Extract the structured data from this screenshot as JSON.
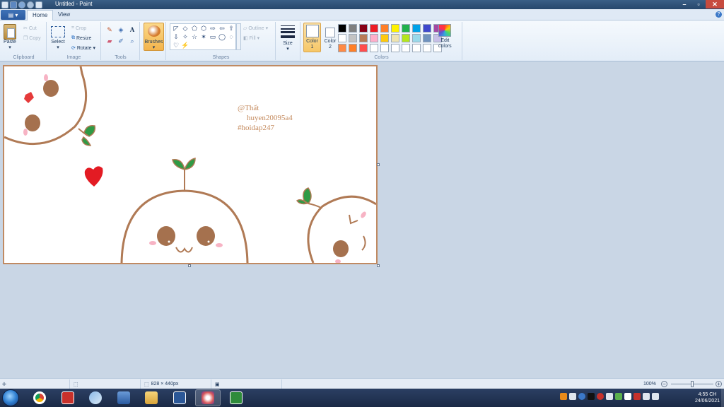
{
  "window": {
    "title": "Untitled - Paint"
  },
  "window_buttons": {
    "minimize": "–",
    "maximize": "▫",
    "close": "✕"
  },
  "tabs": {
    "file": "▤ ▾",
    "home": "Home",
    "view": "View"
  },
  "help": "?",
  "clipboard": {
    "label": "Clipboard",
    "paste": "Paste",
    "cut": "Cut",
    "copy": "Copy"
  },
  "image": {
    "label": "Image",
    "select": "Select",
    "crop": "Crop",
    "resize": "Resize",
    "rotate": "Rotate"
  },
  "tools": {
    "label": "Tools",
    "text_tool": "A"
  },
  "brushes": {
    "label": "Brushes"
  },
  "shapes": {
    "label": "Shapes",
    "glyphs": [
      "◸",
      "◇",
      "⬠",
      "⬡",
      "⇨",
      "⇦",
      "⇧",
      "⇩",
      "✧",
      "☆",
      "✶",
      "▭",
      "◯",
      "◌",
      "♡",
      "⚡"
    ],
    "outline": "Outline",
    "fill": "Fill"
  },
  "size": {
    "label": "Size"
  },
  "colors": {
    "label": "Colors",
    "color1": "Color\n1",
    "color2": "Color\n2",
    "edit": "Edit\ncolors",
    "palette": [
      "#000000",
      "#7f7f7f",
      "#880015",
      "#ed1c24",
      "#ff7f27",
      "#fff200",
      "#22b14c",
      "#00a2e8",
      "#3f48cc",
      "#a349a4",
      "#ffffff",
      "#c3c3c3",
      "#b97a57",
      "#ffaec9",
      "#ffc90e",
      "#efe4b0",
      "#b5e61d",
      "#99d9ea",
      "#7092be",
      "#c8bfe7",
      "#ff8a45",
      "#ff7f27",
      "#ff4d4d",
      "#ffffff",
      "#ffffff",
      "#ffffff",
      "#ffffff",
      "#ffffff",
      "#ffffff",
      "#ffffff"
    ]
  },
  "canvas_text": {
    "line1": "@Thất",
    "line2": "huyen20095a4",
    "line3": "#hoidap247"
  },
  "status": {
    "size": "828 × 440px",
    "zoom": "100%",
    "zoom_out": "−",
    "zoom_in": "+",
    "zoom_level": 0.5
  },
  "clock": {
    "time": "4:55 CH",
    "date": "24/06/2021"
  }
}
